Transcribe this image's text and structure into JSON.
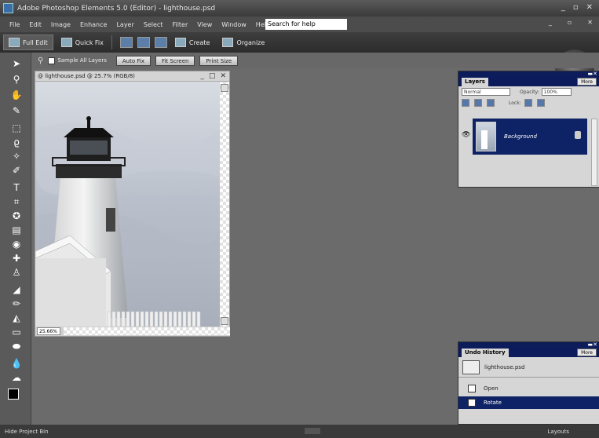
{
  "window": {
    "title": "Adobe Photoshop Elements 5.0 (Editor) - lighthouse.psd"
  },
  "menu": {
    "items": [
      "File",
      "Edit",
      "Image",
      "Enhance",
      "Layer",
      "Select",
      "Filter",
      "View",
      "Window",
      "Help"
    ],
    "help_search": "Search for help"
  },
  "tabs": {
    "full_edit": "Full Edit",
    "quick_fix": "Quick Fix",
    "create": "Create",
    "organize": "Organize"
  },
  "options": {
    "sample_all": "Sample All Layers",
    "auto_fix": "Auto Fix",
    "fit_screen": "Fit Screen",
    "print_size": "Print Size"
  },
  "document": {
    "title": "@ lighthouse.psd @ 25.7% (RGB/8)",
    "zoom": "25.66%"
  },
  "layers": {
    "tab": "Layers",
    "more": "More",
    "blend_mode": "Normal",
    "opacity_label": "Opacity:",
    "opacity": "100%",
    "lock_label": "Lock:",
    "layer_name": "Background"
  },
  "undo_history": {
    "tab": "Undo History",
    "more": "More",
    "snapshot": "lighthouse.psd",
    "items": [
      "Open",
      "Rotate"
    ],
    "selected": 1
  },
  "status": {
    "left": "Hide Project Bin",
    "right": "Layouts"
  },
  "colors": {
    "panel_header": "#0b1b5c",
    "selection": "#0e2366",
    "workspace": "#6b6b6b"
  }
}
